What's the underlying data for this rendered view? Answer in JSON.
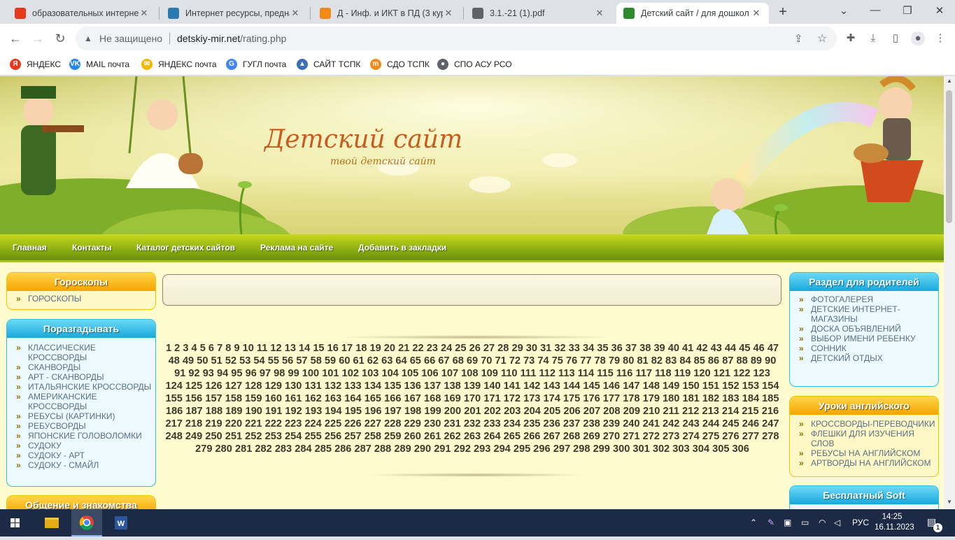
{
  "tabs": [
    {
      "title": "образовательных интернет",
      "favicon": "yandex-icon",
      "color": "#e8381b"
    },
    {
      "title": "Интернет ресурсы, предна",
      "favicon": "book-icon",
      "color": "#2a7ab0"
    },
    {
      "title": "Д - Инф. и ИКТ в ПД (3 кур",
      "favicon": "moodle-icon",
      "color": "#f28a1a"
    },
    {
      "title": "3.1.-21 (1).pdf",
      "favicon": "globe-icon",
      "color": "#5f6368"
    },
    {
      "title": "Детский сайт / для дошкол",
      "favicon": "site-icon",
      "color": "#2b8a2b"
    }
  ],
  "address": {
    "insecure_label": "Не защищено",
    "host": "detskiy-mir.net",
    "path": "/rating.php"
  },
  "bookmarks": [
    {
      "label": "ЯНДЕКС",
      "icon": "yandex-icon",
      "color": "#e8381b",
      "glyph": "Я"
    },
    {
      "label": "MAIL почта",
      "icon": "vk-icon",
      "color": "#2787f5",
      "glyph": "VK"
    },
    {
      "label": "ЯНДЕКС почта",
      "icon": "mail-icon",
      "color": "#f3b800",
      "glyph": "✉"
    },
    {
      "label": "ГУГЛ почта",
      "icon": "google-icon",
      "color": "#4285f4",
      "glyph": "G"
    },
    {
      "label": "САЙТ ТСПК",
      "icon": "triangle-icon",
      "color": "#3d6fb6",
      "glyph": "▲"
    },
    {
      "label": "СДО ТСПК",
      "icon": "moodle-icon",
      "color": "#f28a1a",
      "glyph": "m"
    },
    {
      "label": "СПО АСУ РСО",
      "icon": "globe-icon",
      "color": "#5f6368",
      "glyph": "●"
    }
  ],
  "site": {
    "logo_title": "Детский сайт",
    "logo_subtitle": "твой детский сайт"
  },
  "nav": [
    "Главная",
    "Контакты",
    "Каталог детских сайтов",
    "Реклама на сайте",
    "Добавить в закладки"
  ],
  "left_boxes": [
    {
      "title": "Гороскопы",
      "items": [
        "ГОРОСКОПЫ"
      ]
    },
    {
      "title": "Поразгадывать",
      "items": [
        "КЛАССИЧЕСКИЕ КРОССВОРДЫ",
        "СКАНВОРДЫ",
        "АРТ - СКАНВОРДЫ",
        "ИТАЛЬЯНСКИЕ КРОССВОРДЫ",
        "АМЕРИКАНСКИЕ КРОССВОРДЫ",
        "РЕБУСЫ (КАРТИНКИ)",
        "РЕБУСВОРДЫ",
        "ЯПОНСКИЕ ГОЛОВОЛОМКИ",
        "СУДОКУ",
        "СУДОКУ - АРТ",
        "СУДОКУ - СМАЙЛ"
      ]
    },
    {
      "title": "Общение и знакомства",
      "items": []
    }
  ],
  "right_boxes": [
    {
      "title": "Раздел для родителей",
      "items": [
        "ФОТОГАЛЕРЕЯ",
        "ДЕТСКИЕ ИНТЕРНЕТ-МАГАЗИНЫ",
        "ДОСКА ОБЪЯВЛЕНИЙ",
        "ВЫБОР ИМЕНИ РЕБЕНКУ",
        "СОННИК",
        "ДЕТСКИЙ ОТДЫХ"
      ]
    },
    {
      "title": "Уроки английского",
      "items": [
        "КРОССВОРДЫ-ПЕРЕВОДЧИКИ",
        "ФЛЕШКИ ДЛЯ ИЗУЧЕНИЯ СЛОВ",
        "РЕБУСЫ НА АНГЛИЙСКОМ",
        "АРТВОРДЫ НА АНГЛИЙСКОМ"
      ]
    },
    {
      "title": "Бесплатный Soft",
      "items": []
    }
  ],
  "pagination": {
    "first": 1,
    "last": 306
  },
  "taskbar": {
    "language": "РУС",
    "time": "14:25",
    "date": "16.11.2023",
    "notifications": "1"
  }
}
